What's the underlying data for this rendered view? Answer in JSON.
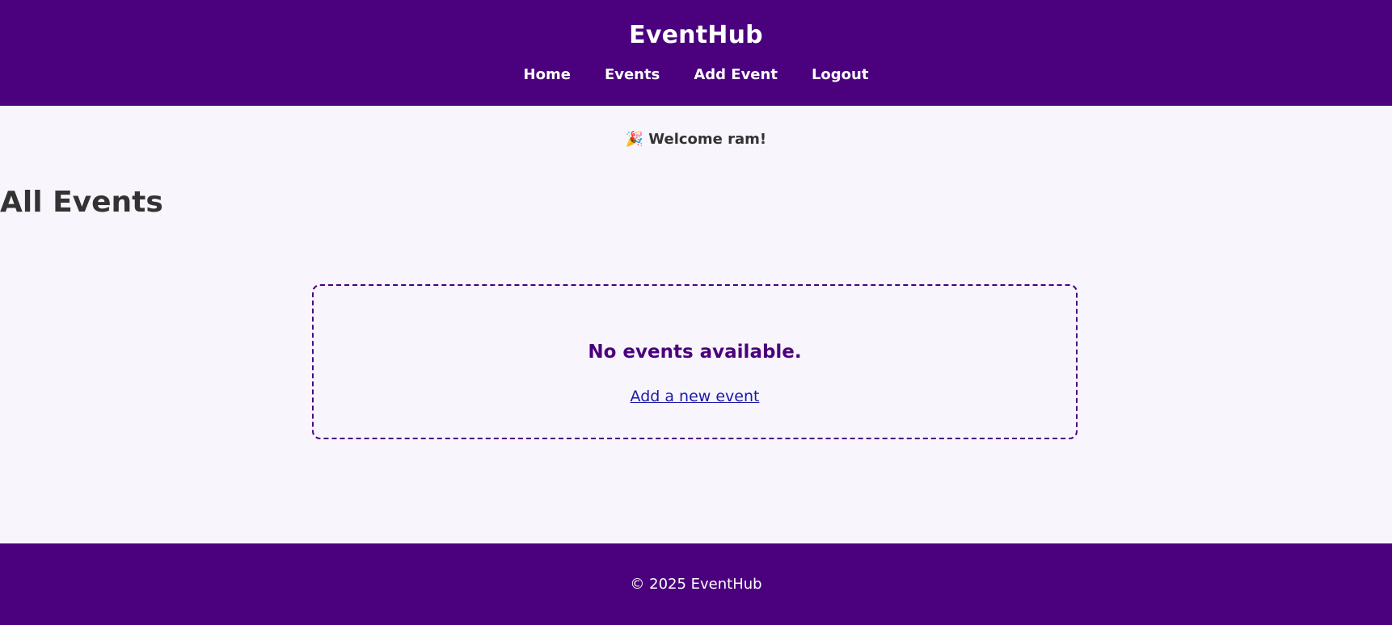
{
  "header": {
    "brand": "EventHub",
    "nav": [
      {
        "label": "Home"
      },
      {
        "label": "Events"
      },
      {
        "label": "Add Event"
      },
      {
        "label": "Logout"
      }
    ]
  },
  "welcome": {
    "emoji": "🎉",
    "text": "Welcome ram!"
  },
  "main": {
    "title": "All Events",
    "empty_state": {
      "message": "No events available.",
      "link_label": "Add a new event"
    }
  },
  "footer": {
    "text": "© 2025 EventHub"
  },
  "colors": {
    "brand_purple": "#4b007d",
    "page_background": "#f8f5fd",
    "link_blue": "#1a1aa6"
  }
}
